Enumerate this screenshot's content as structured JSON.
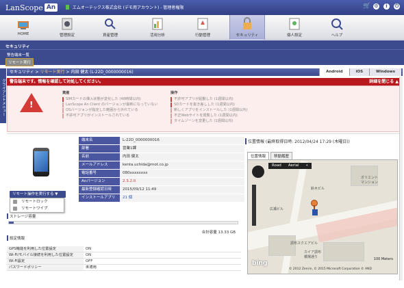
{
  "header": {
    "logo_text": "LanScope",
    "logo_badge": "An",
    "account": "エムオーテックス株式会社 (デモ用アカウント) - 管理者権限"
  },
  "nav": [
    {
      "label": "HOME",
      "icon": "home-icon"
    },
    {
      "label": "管理設定",
      "icon": "settings-icon"
    },
    {
      "label": "資産管理",
      "icon": "asset-icon"
    },
    {
      "label": "活用分析",
      "icon": "analysis-icon"
    },
    {
      "label": "行動管理",
      "icon": "activity-icon"
    },
    {
      "label": "セキュリティ",
      "icon": "security-icon"
    },
    {
      "label": "個人設定",
      "icon": "user-icon"
    },
    {
      "label": "ヘルプ",
      "icon": "help-icon"
    }
  ],
  "security": {
    "title": "セキュリティ",
    "sub_item": "警告端末一覧",
    "sub_item_active": "リモート実行"
  },
  "side_tab": "クライアントメニュー",
  "breadcrumb": {
    "root": "セキュリティ",
    "sep1": " > ",
    "link": "リモート実行",
    "sep2": " > ",
    "current": "内田 健太 (L-22D_0000000016)"
  },
  "os_tabs": [
    "Android",
    "iOS",
    "Windows"
  ],
  "alert": {
    "message": "警告端末です。情報を確認して対処してください。",
    "close": "詳細を閉じる ▲"
  },
  "warnings": {
    "left_header": "資産",
    "left_items": [
      "SIMカードの挿入状態が変化した (48時間以内)",
      "LanScope An Client のバージョンが最新になっていない",
      "OSバージョンが指定した範囲から外れている",
      "不許可アプリがインストールされている"
    ],
    "right_header": "操作",
    "right_items": [
      "不許可アプリが起動した (1週間以内)",
      "SDカードを抜き差しした (1週間以内)",
      "新しくアプリをインストールした (1週間以内)",
      "不正Webサイトを閲覧した (1週間以内)",
      "タイムゾーンを変更した (1週間以内)"
    ]
  },
  "device": {
    "rows": [
      {
        "key": "端末名",
        "value": "L-22D_0000000016",
        "style": ""
      },
      {
        "key": "部署",
        "value": "営業1課",
        "style": ""
      },
      {
        "key": "名前",
        "value": "内田 健太",
        "style": ""
      },
      {
        "key": "メールアドレス",
        "value": "kenta.uchida@mot.co.jp",
        "style": ""
      },
      {
        "key": "電話番号",
        "value": "080xxxxxxxx",
        "style": ""
      },
      {
        "key": "Anバージョン",
        "value": "2.3.2.0",
        "style": "red"
      },
      {
        "key": "最新登録確認日時",
        "value": "2015/09/12 11:49",
        "style": ""
      },
      {
        "key": "インストールアプリ",
        "value": "21 個",
        "style": "blue"
      }
    ]
  },
  "remote": {
    "button_label": "リモート操作を実行する ▼",
    "menu": [
      {
        "label": "リモートロック",
        "icon": "lock-icon"
      },
      {
        "label": "リモートワイプ",
        "icon": "trash-icon"
      }
    ]
  },
  "storage": {
    "label": "ストレージ容量",
    "fill": 0.02,
    "total": "合計容量 13.33 GB"
  },
  "settings": {
    "title": "設定情報",
    "rows": [
      {
        "key": "GPS機能を利用した位置設定",
        "value": "ON"
      },
      {
        "key": "Wi-Fi/モバイル接続を利用した位置設定",
        "value": "ON"
      },
      {
        "key": "Wi-Fi設定",
        "value": "OFF"
      },
      {
        "key": "パスワードポリシー",
        "value": "未適用"
      }
    ]
  },
  "map": {
    "header": "位置情報 (最終取得日時: 2012/04/24 17:29 (木曜日))",
    "tabs": [
      "位置情報",
      "移動履歴"
    ],
    "modes": [
      "Road",
      "Aerial",
      "«"
    ],
    "labels": [
      "オリエント\nマンション",
      "鈴木ビル",
      "広瀬ビル",
      "調布スクエアビル",
      "カイア調布\n橋場通り"
    ],
    "scale": "100 Meters",
    "copyright": "© 2012 Zenrin, © 2015 Microsoft Corporation  © AND",
    "brand": "bing"
  },
  "colors": {
    "primary": "#3c4a8e",
    "alert": "#b8181e",
    "accent": "#f5c470"
  }
}
